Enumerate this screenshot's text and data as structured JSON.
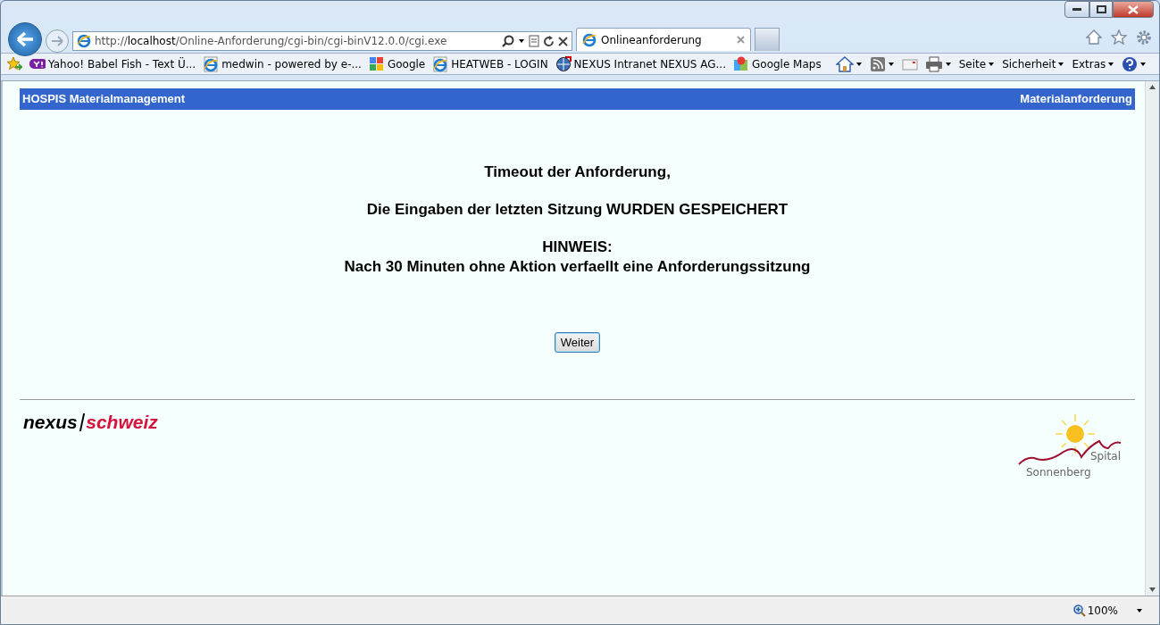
{
  "window": {
    "address": "http://**localhost**/Online-Anforderung/cgi-bin/cgi-binV12.0.0/cgi.exe"
  },
  "tabs": [
    {
      "label": "Onlineanforderung",
      "selected": true
    }
  ],
  "favorites": [
    {
      "label": "Yahoo! Babel Fish - Text Ü...",
      "kind": "yahoo"
    },
    {
      "label": "medwin - powered by e-...",
      "kind": "ie"
    },
    {
      "label": "Google",
      "kind": "google"
    },
    {
      "label": "HEATWEB - LOGIN",
      "kind": "ie"
    },
    {
      "label": "NEXUS Intranet NEXUS AG...",
      "kind": "globe"
    },
    {
      "label": "Google Maps",
      "kind": "maps"
    }
  ],
  "command_bar": [
    "Seite",
    "Sicherheit",
    "Extras"
  ],
  "page": {
    "header_left": "HOSPIS Materialmanagement",
    "header_right": "Materialanforderung",
    "paragraphs": [
      [
        "Timeout der Anforderung,"
      ],
      [
        "Die Eingaben der letzten Sitzung WURDEN GESPEICHERT"
      ],
      [
        "HINWEIS:",
        "Nach 30 Minuten ohne Aktion verfaellt eine Anforderungssitzung"
      ]
    ],
    "button": "Weiter",
    "logo_left": [
      "nexus",
      "schweiz"
    ],
    "logo_right": [
      "Spital",
      "Sonnenberg"
    ]
  },
  "status_bar": {
    "zoom": "100%"
  }
}
